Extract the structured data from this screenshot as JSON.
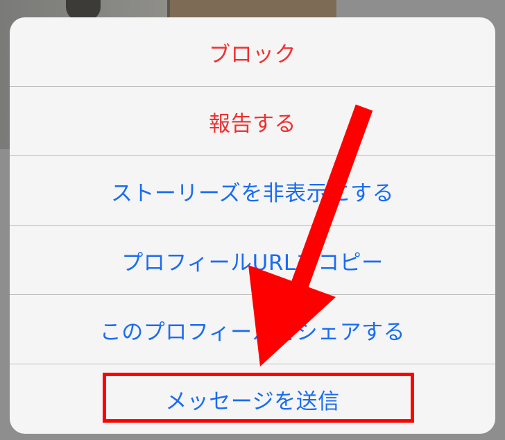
{
  "menu": {
    "items": [
      {
        "label": "ブロック",
        "color": "#f03030"
      },
      {
        "label": "報告する",
        "color": "#f03030"
      },
      {
        "label": "ストーリーズを非表示にする",
        "color": "#1a6cf2"
      },
      {
        "label": "プロフィールURLをコピー",
        "color": "#1a6cf2"
      },
      {
        "label": "このプロフィールをシェアする",
        "color": "#1a6cf2"
      },
      {
        "label": "メッセージを送信",
        "color": "#1a6cf2"
      }
    ]
  },
  "annotation": {
    "arrow_color": "#ff0000",
    "highlight_color": "#ff0000",
    "highlight_target": "メッセージを送信"
  }
}
